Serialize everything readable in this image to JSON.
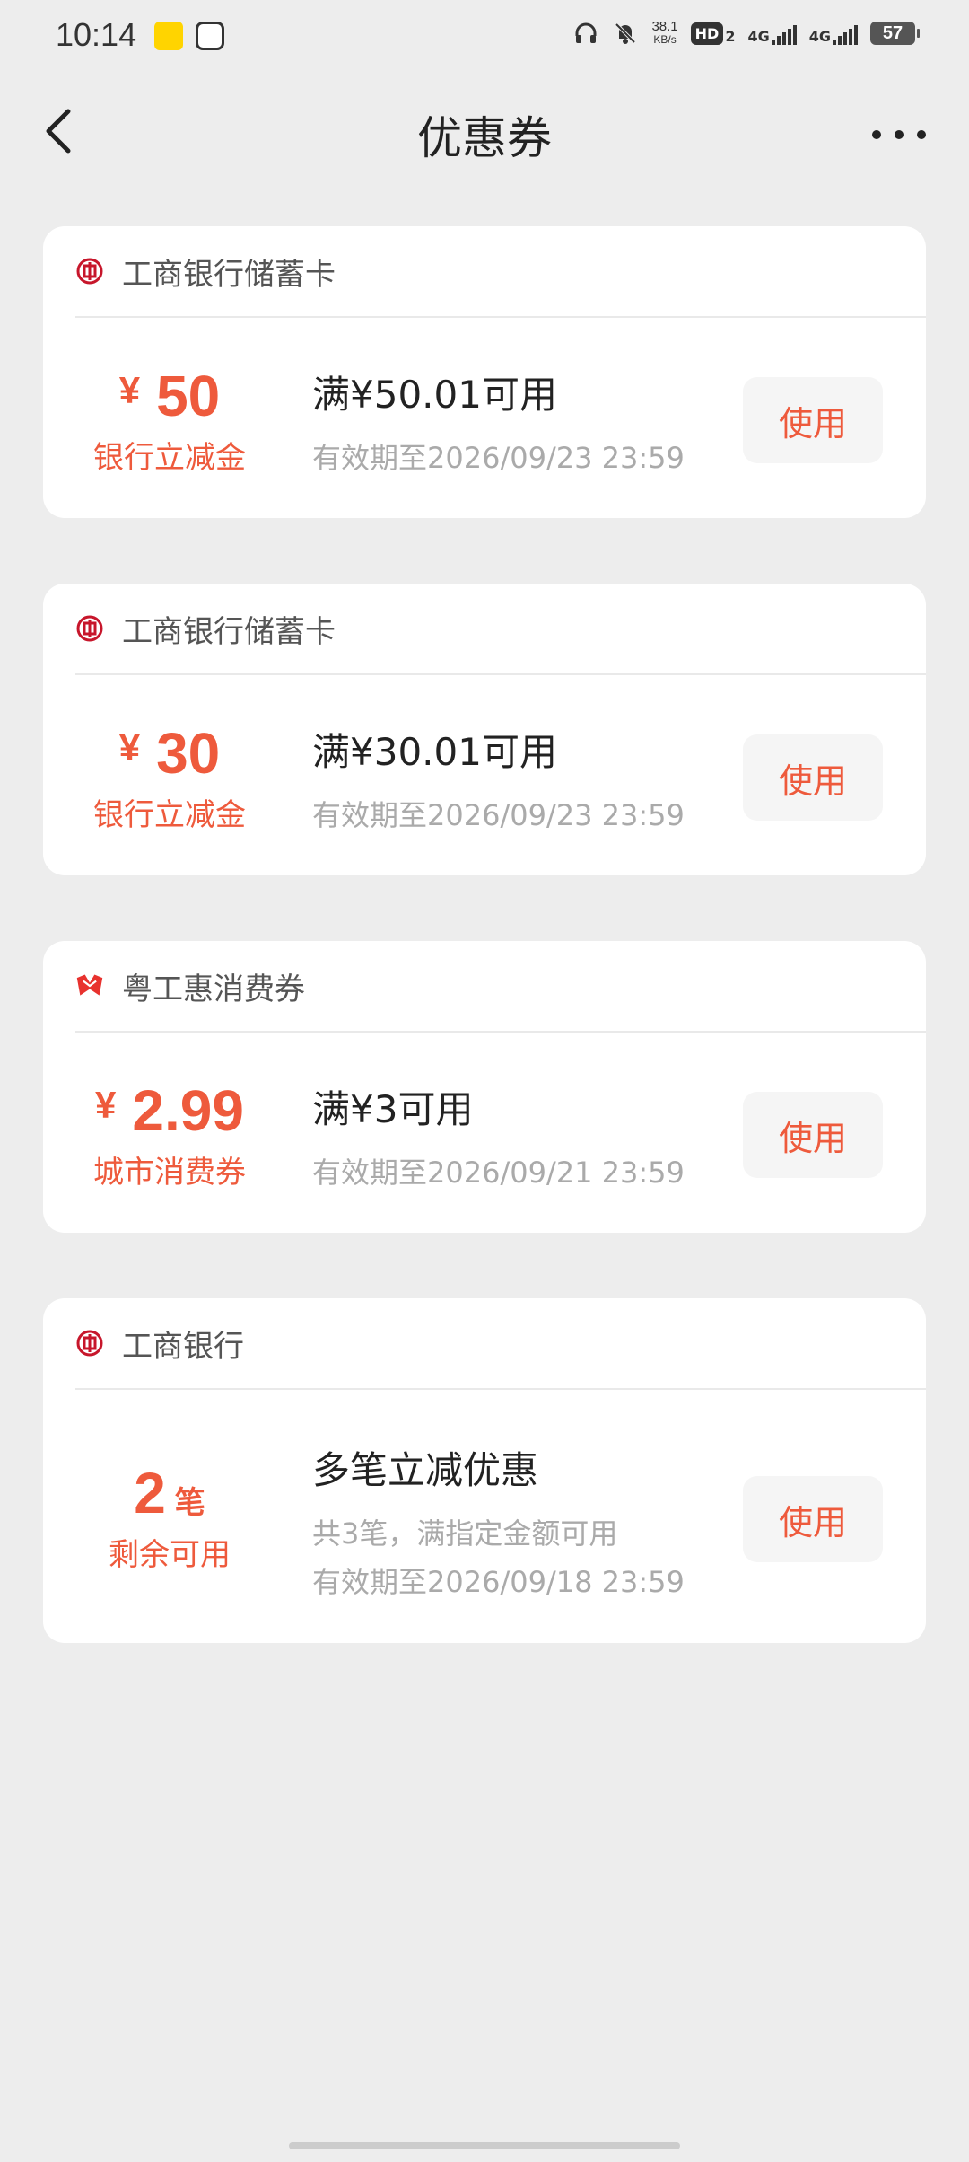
{
  "status_bar": {
    "time": "10:14",
    "speed_value": "38.1",
    "speed_unit": "KB/s",
    "hd_label": "HD",
    "hd_sub": "2",
    "net1": "4G",
    "net2": "4G",
    "battery": "57"
  },
  "header": {
    "title": "优惠券"
  },
  "coupons": [
    {
      "issuer": "工商银行储蓄卡",
      "issuer_icon": "icbc-logo-icon",
      "yen": "¥",
      "amount": "50",
      "unit": "",
      "sub_label": "银行立减金",
      "title": "满¥50.01可用",
      "lines": [
        "有效期至2026/09/23 23:59"
      ],
      "button": "使用"
    },
    {
      "issuer": "工商银行储蓄卡",
      "issuer_icon": "icbc-logo-icon",
      "yen": "¥",
      "amount": "30",
      "unit": "",
      "sub_label": "银行立减金",
      "title": "满¥30.01可用",
      "lines": [
        "有效期至2026/09/23 23:59"
      ],
      "button": "使用"
    },
    {
      "issuer": "粤工惠消费券",
      "issuer_icon": "yuegonghui-logo-icon",
      "yen": "¥",
      "amount": "2.99",
      "unit": "",
      "sub_label": "城市消费券",
      "title": "满¥3可用",
      "lines": [
        "有效期至2026/09/21 23:59"
      ],
      "button": "使用"
    },
    {
      "issuer": "工商银行",
      "issuer_icon": "icbc-logo-icon",
      "yen": "",
      "amount": "2",
      "unit": "笔",
      "sub_label": "剩余可用",
      "title": "多笔立减优惠",
      "lines": [
        "共3笔，满指定金额可用",
        "有效期至2026/09/18 23:59"
      ],
      "button": "使用"
    }
  ],
  "colors": {
    "accent": "#EE5A3C",
    "background": "#EDEDED",
    "card": "#FFFFFF",
    "muted_text": "#AAAAAA",
    "icbc_red": "#C7162B"
  }
}
